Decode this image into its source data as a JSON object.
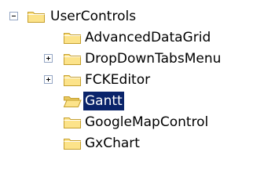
{
  "tree": {
    "root": {
      "label": "UserControls",
      "expander": "collapse-minus",
      "icon": "folder-icon"
    },
    "children": [
      {
        "label": "AdvancedDataGrid",
        "expander": "none",
        "icon": "folder-icon"
      },
      {
        "label": "DropDownTabsMenu",
        "expander": "expand-plus",
        "icon": "folder-icon"
      },
      {
        "label": "FCKEditor",
        "expander": "expand-plus",
        "icon": "folder-icon"
      },
      {
        "label": "Gantt",
        "expander": "none",
        "icon": "folder-open-icon",
        "selected": true
      },
      {
        "label": "GoogleMapControl",
        "expander": "none",
        "icon": "folder-icon"
      },
      {
        "label": "GxChart",
        "expander": "none",
        "icon": "folder-icon"
      }
    ]
  },
  "colors": {
    "selection_background": "#0a246a",
    "selection_text": "#ffffff",
    "expander_border": "#94a6c4",
    "folder_fill": "#fce38a",
    "folder_outline": "#c59f2c"
  }
}
